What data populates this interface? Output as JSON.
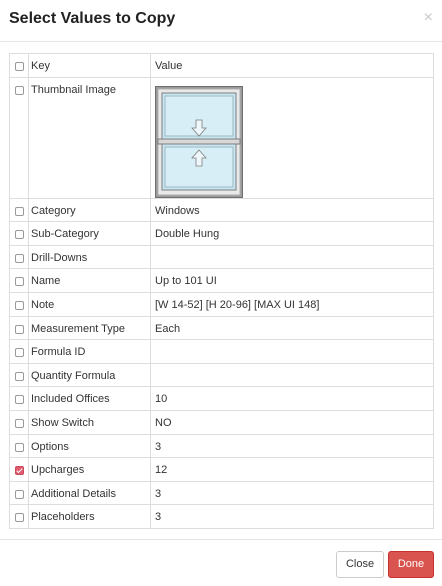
{
  "modal": {
    "title": "Select Values to Copy",
    "close_symbol": "×"
  },
  "table": {
    "header": {
      "key": "Key",
      "value": "Value"
    },
    "thumbnail_row": {
      "key": "Thumbnail Image",
      "image": "double-hung-window-thumbnail"
    },
    "rows": [
      {
        "key": "Category",
        "value": "Windows",
        "checked": false
      },
      {
        "key": "Sub-Category",
        "value": "Double Hung",
        "checked": false
      },
      {
        "key": "Drill-Downs",
        "value": "",
        "checked": false
      },
      {
        "key": "Name",
        "value": "Up to 101 UI",
        "checked": false
      },
      {
        "key": "Note",
        "value": "[W 14-52] [H 20-96] [MAX UI 148]",
        "checked": false
      },
      {
        "key": "Measurement Type",
        "value": "Each",
        "checked": false
      },
      {
        "key": "Formula ID",
        "value": "",
        "checked": false
      },
      {
        "key": "Quantity Formula",
        "value": "",
        "checked": false
      },
      {
        "key": "Included Offices",
        "value": "10",
        "checked": false
      },
      {
        "key": "Show Switch",
        "value": "NO",
        "checked": false
      },
      {
        "key": "Options",
        "value": "3",
        "checked": false
      },
      {
        "key": "Upcharges",
        "value": "12",
        "checked": true
      },
      {
        "key": "Additional Details",
        "value": "3",
        "checked": false
      },
      {
        "key": "Placeholders",
        "value": "3",
        "checked": false
      }
    ]
  },
  "footer": {
    "close_label": "Close",
    "done_label": "Done"
  },
  "colors": {
    "accent": "#d9534f",
    "checked": "#e25b6d"
  }
}
